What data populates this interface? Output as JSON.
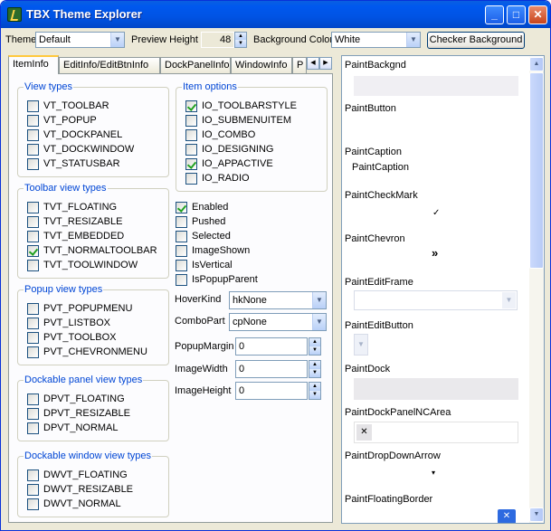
{
  "window": {
    "title": "TBX Theme Explorer",
    "min_icon": "_",
    "max_icon": "□",
    "close_icon": "✕"
  },
  "toolbar": {
    "theme_label": "Theme",
    "theme_value": "Default",
    "preview_height_label": "Preview Height",
    "preview_height_value": "48",
    "bg_color_label": "Background Color",
    "bg_color_value": "White",
    "checker_button": "Checker Background"
  },
  "tabs": {
    "items": [
      "ItemInfo",
      "EditInfo/EditBtnInfo",
      "DockPanelInfo",
      "WindowInfo",
      "P"
    ],
    "prev": "◀",
    "next": "▶"
  },
  "view_types": {
    "caption": "View types",
    "items": [
      {
        "label": "VT_TOOLBAR",
        "checked": false
      },
      {
        "label": "VT_POPUP",
        "checked": false
      },
      {
        "label": "VT_DOCKPANEL",
        "checked": false
      },
      {
        "label": "VT_DOCKWINDOW",
        "checked": false
      },
      {
        "label": "VT_STATUSBAR",
        "checked": false
      }
    ]
  },
  "toolbar_view_types": {
    "caption": "Toolbar view types",
    "items": [
      {
        "label": "TVT_FLOATING",
        "checked": false
      },
      {
        "label": "TVT_RESIZABLE",
        "checked": false
      },
      {
        "label": "TVT_EMBEDDED",
        "checked": false
      },
      {
        "label": "TVT_NORMALTOOLBAR",
        "checked": true
      },
      {
        "label": "TVT_TOOLWINDOW",
        "checked": false
      }
    ]
  },
  "popup_view_types": {
    "caption": "Popup view types",
    "items": [
      {
        "label": "PVT_POPUPMENU",
        "checked": false
      },
      {
        "label": "PVT_LISTBOX",
        "checked": false
      },
      {
        "label": "PVT_TOOLBOX",
        "checked": false
      },
      {
        "label": "PVT_CHEVRONMENU",
        "checked": false
      }
    ]
  },
  "dock_panel_view_types": {
    "caption": "Dockable panel view types",
    "items": [
      {
        "label": "DPVT_FLOATING",
        "checked": false
      },
      {
        "label": "DPVT_RESIZABLE",
        "checked": false
      },
      {
        "label": "DPVT_NORMAL",
        "checked": false
      }
    ]
  },
  "dock_window_view_types": {
    "caption": "Dockable window view types",
    "items": [
      {
        "label": "DWVT_FLOATING",
        "checked": false
      },
      {
        "label": "DWVT_RESIZABLE",
        "checked": false
      },
      {
        "label": "DWVT_NORMAL",
        "checked": false
      }
    ]
  },
  "item_options": {
    "caption": "Item options",
    "items": [
      {
        "label": "IO_TOOLBARSTYLE",
        "checked": true
      },
      {
        "label": "IO_SUBMENUITEM",
        "checked": false
      },
      {
        "label": "IO_COMBO",
        "checked": false
      },
      {
        "label": "IO_DESIGNING",
        "checked": false
      },
      {
        "label": "IO_APPACTIVE",
        "checked": true
      },
      {
        "label": "IO_RADIO",
        "checked": false
      }
    ]
  },
  "states": [
    {
      "label": "Enabled",
      "checked": true
    },
    {
      "label": "Pushed",
      "checked": false
    },
    {
      "label": "Selected",
      "checked": false
    },
    {
      "label": "ImageShown",
      "checked": false
    },
    {
      "label": "IsVertical",
      "checked": false
    },
    {
      "label": "IsPopupParent",
      "checked": false
    }
  ],
  "fields": {
    "hover_kind_label": "HoverKind",
    "hover_kind_value": "hkNone",
    "combo_part_label": "ComboPart",
    "combo_part_value": "cpNone",
    "popup_margin_label": "PopupMargin",
    "popup_margin_value": "0",
    "image_width_label": "ImageWidth",
    "image_width_value": "0",
    "image_height_label": "ImageHeight",
    "image_height_value": "0"
  },
  "preview": {
    "items": [
      "PaintBackgnd",
      "PaintButton",
      "PaintCaption",
      "PaintCheckMark",
      "PaintChevron",
      "PaintEditFrame",
      "PaintEditButton",
      "PaintDock",
      "PaintDockPanelNCArea",
      "PaintDropDownArrow",
      "PaintFloatingBorder"
    ],
    "caption_sample": "PaintCaption",
    "checkmark_glyph": "✓",
    "chevron_glyph": "»",
    "x_glyph": "✕",
    "arrow_glyph": "▾"
  },
  "icons": {
    "dropdown": "chevron-down-icon",
    "spin_up": "▲",
    "spin_down": "▼"
  }
}
